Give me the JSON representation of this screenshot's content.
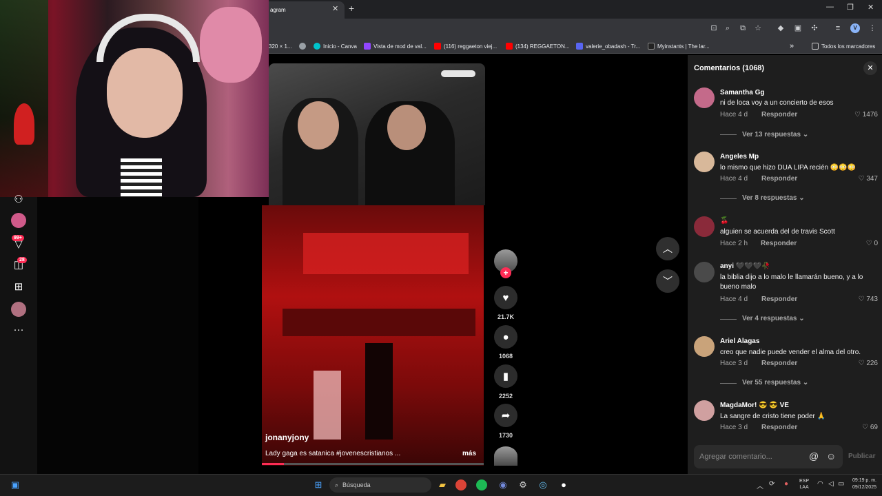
{
  "browser": {
    "tab_title": "agram",
    "tab_close": "✕",
    "new_tab": "+",
    "window_controls": [
      "—",
      "❐",
      "✕"
    ],
    "profile_initial": "V",
    "bookmarks": [
      {
        "label": "320 × 1...",
        "color": "#9aa0a6"
      },
      {
        "label": "",
        "color": "#9aa0a6"
      },
      {
        "label": "Inicio - Canva",
        "color": "#00c4cc"
      },
      {
        "label": "Vista de mod de val...",
        "color": "#9146ff"
      },
      {
        "label": "(116) reggaeton viej...",
        "color": "#ff0000"
      },
      {
        "label": "(134) REGGAETON...",
        "color": "#ff0000"
      },
      {
        "label": "valerie_obadash - Tr...",
        "color": "#5865f2"
      },
      {
        "label": "Myinstants | The lar...",
        "color": "#222"
      }
    ],
    "bookmarks_overflow": "»",
    "all_bookmarks": "Todos los marcadores"
  },
  "leftrail": {
    "badge_1": "99+",
    "badge_2": "28",
    "icons": [
      "people-icon",
      "live-avatar-icon",
      "inbox-icon",
      "messages-icon",
      "upload-icon",
      "profile-icon",
      "more-icon"
    ]
  },
  "video": {
    "author": "jonanyjony",
    "caption": "Lady gaga es satanica #jovenescristianos ...",
    "more": "más",
    "progress": 0.1,
    "likes": "21.7K",
    "comments": "1068",
    "saves": "2252",
    "shares": "1730"
  },
  "comments_panel": {
    "title": "Comentarios (1068)",
    "reply_label": "Responder",
    "placeholder": "Agregar comentario...",
    "publish": "Publicar",
    "items": [
      {
        "name": "Samantha Gg",
        "text": "ni de loca voy a un concierto de esos",
        "time": "Hace 4 d",
        "likes": "1476",
        "replies": "Ver 13 respuestas",
        "avatar": "#c46a8a"
      },
      {
        "name": "Angeles Mp",
        "text": "lo mismo que hizo DUA LIPA recién 😳😳😳",
        "time": "Hace 4 d",
        "likes": "347",
        "replies": "Ver 8 respuestas",
        "avatar": "#d8b89a"
      },
      {
        "name": "🍒",
        "text": "alguien se acuerda del de travis Scott",
        "time": "Hace 2 h",
        "likes": "0",
        "replies": "",
        "avatar": "#8a2a3a"
      },
      {
        "name": "anyi 🖤🖤🖤🥀",
        "text": "la biblia dijo a lo malo le llamarán bueno, y a lo bueno malo",
        "time": "Hace 4 d",
        "likes": "743",
        "replies": "Ver 4 respuestas",
        "avatar": "#4a4a4a"
      },
      {
        "name": "Ariel Alagas",
        "text": "creo que nadie puede vender el alma del otro.",
        "time": "Hace 3 d",
        "likes": "226",
        "replies": "Ver 55 respuestas",
        "avatar": "#c9a37a"
      },
      {
        "name": "MagdaMor! 😎 😎 VE",
        "text": "La sangre de cristo tiene poder 🙏",
        "time": "Hace 3 d",
        "likes": "69",
        "replies": "",
        "avatar": "#d0a0a0"
      }
    ]
  },
  "taskbar": {
    "search": "Búsqueda",
    "lang": [
      "ESP",
      "LAA"
    ],
    "time": "09:19 p. m.",
    "date": "09/12/2025"
  }
}
